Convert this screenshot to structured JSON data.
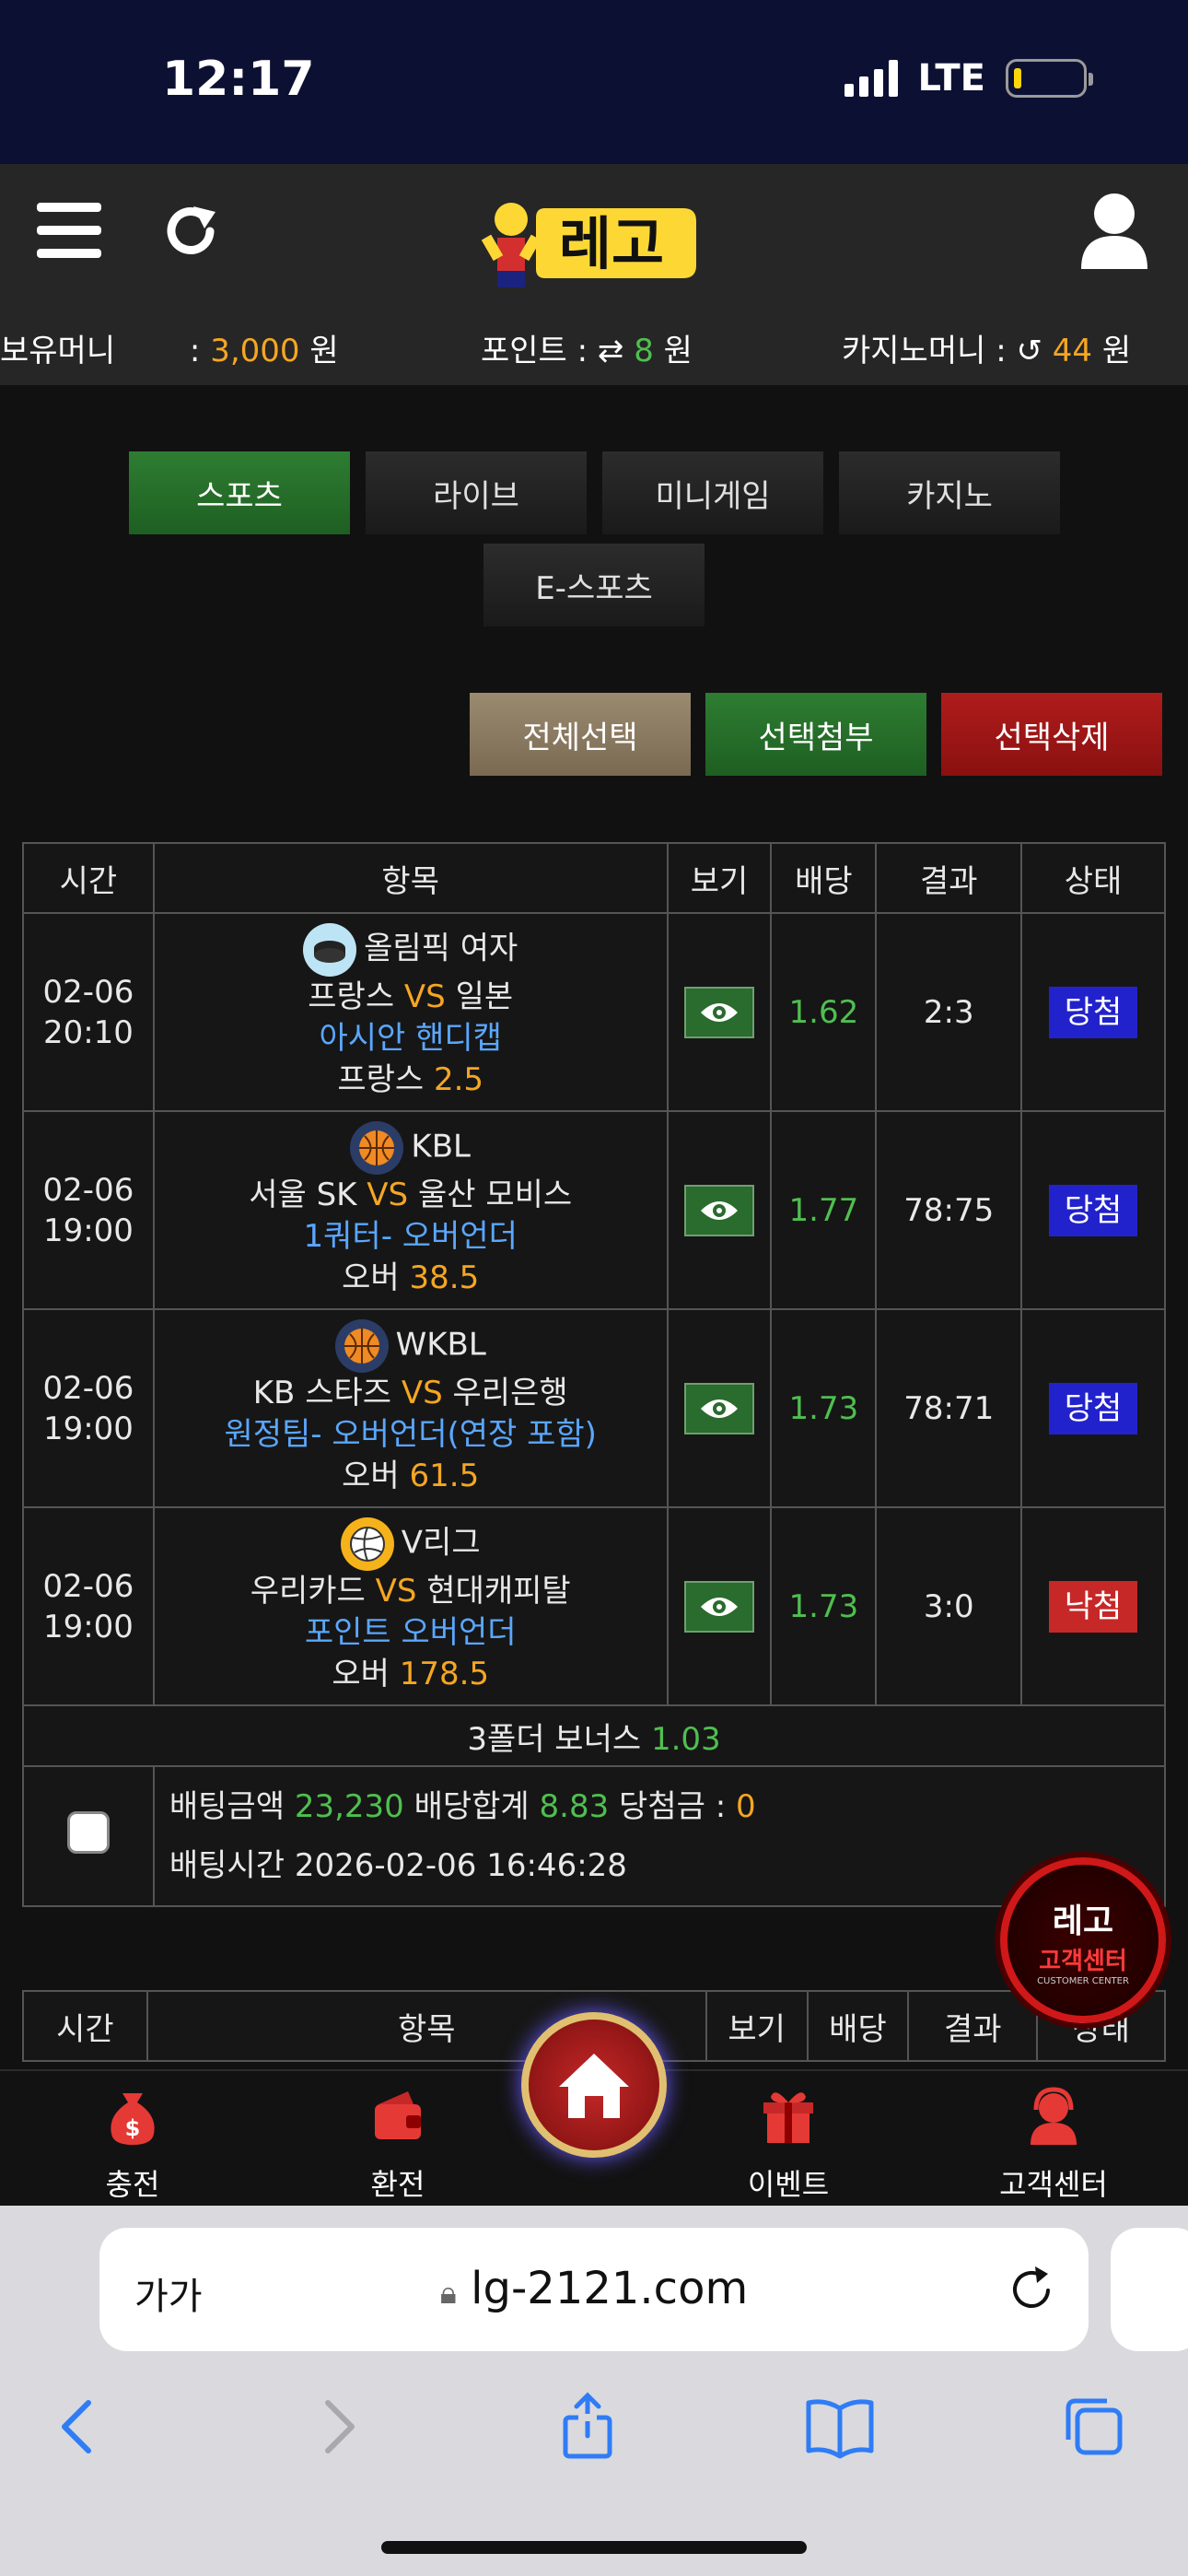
{
  "status_bar": {
    "time": "12:17",
    "network": "LTE"
  },
  "header": {
    "logo_text": "레고",
    "balance_label": "보유머니",
    "balance_sep": " : ",
    "balance_value": "3,000",
    "points_label": "포인트 : ",
    "points_value": "8",
    "casino_label": "카지노머니 : ",
    "casino_value": "44",
    "currency": " 원"
  },
  "tabs": [
    "스포츠",
    "라이브",
    "미니게임",
    "카지노",
    "E-스포츠"
  ],
  "actions": {
    "select_all": "전체선택",
    "attach_selected": "선택첨부",
    "delete_selected": "선택삭제"
  },
  "table": {
    "headers": [
      "시간",
      "항목",
      "보기",
      "배당",
      "결과",
      "상태"
    ],
    "rows": [
      {
        "date": "02-06",
        "time": "20:10",
        "sport_icon": "hockey-puck-icon",
        "league": "올림픽 여자",
        "home": "프랑스",
        "vs": "VS",
        "away": "일본",
        "market": "아시안 핸디캡",
        "pick": "프랑스",
        "pick_value": "2.5",
        "odds": "1.62",
        "result": "2:3",
        "status": "당첨",
        "status_type": "win"
      },
      {
        "date": "02-06",
        "time": "19:00",
        "sport_icon": "basketball-icon",
        "league": "KBL",
        "home": "서울 SK",
        "vs": "VS",
        "away": "울산 모비스",
        "market": "1쿼터- 오버언더",
        "pick": "오버",
        "pick_value": "38.5",
        "odds": "1.77",
        "result": "78:75",
        "status": "당첨",
        "status_type": "win"
      },
      {
        "date": "02-06",
        "time": "19:00",
        "sport_icon": "basketball-icon",
        "league": "WKBL",
        "home": "KB 스타즈",
        "vs": "VS",
        "away": "우리은행",
        "market": "원정팀- 오버언더(연장 포함)",
        "pick": "오버",
        "pick_value": "61.5",
        "odds": "1.73",
        "result": "78:71",
        "status": "당첨",
        "status_type": "win"
      },
      {
        "date": "02-06",
        "time": "19:00",
        "sport_icon": "volleyball-icon",
        "league": "V리그",
        "home": "우리카드",
        "vs": "VS",
        "away": "현대캐피탈",
        "market": "포인트 오버언더",
        "pick": "오버",
        "pick_value": "178.5",
        "odds": "1.73",
        "result": "3:0",
        "status": "낙첨",
        "status_type": "lose"
      }
    ],
    "bonus_label": "3폴더 보너스",
    "bonus_value": "1.03",
    "summary": {
      "amount_label": "배팅금액",
      "amount_value": "23,230",
      "total_odds_label": "배당합계",
      "total_odds_value": "8.83",
      "winnings_label": "당첨금 : ",
      "winnings_value": "0",
      "time_label": "배팅시간",
      "time_value": "2026-02-06 16:46:28"
    }
  },
  "table2_headers": [
    "시간",
    "항목",
    "보기",
    "배당",
    "결과",
    "상태"
  ],
  "cs_float": {
    "logo": "레고",
    "label": "고객센터",
    "sub": "CUSTOMER CENTER"
  },
  "bottom_nav": {
    "deposit": "충전",
    "withdraw": "환전",
    "event": "이벤트",
    "support": "고객센터"
  },
  "browser": {
    "aa": "가가",
    "url": "lg-2121.com"
  },
  "colors": {
    "accent_green": "#2e7d32",
    "brown": "#8a7a62",
    "red": "#a31515",
    "win_blue": "#2222cc",
    "lose_red": "#c62828",
    "orange": "#f5a623"
  }
}
